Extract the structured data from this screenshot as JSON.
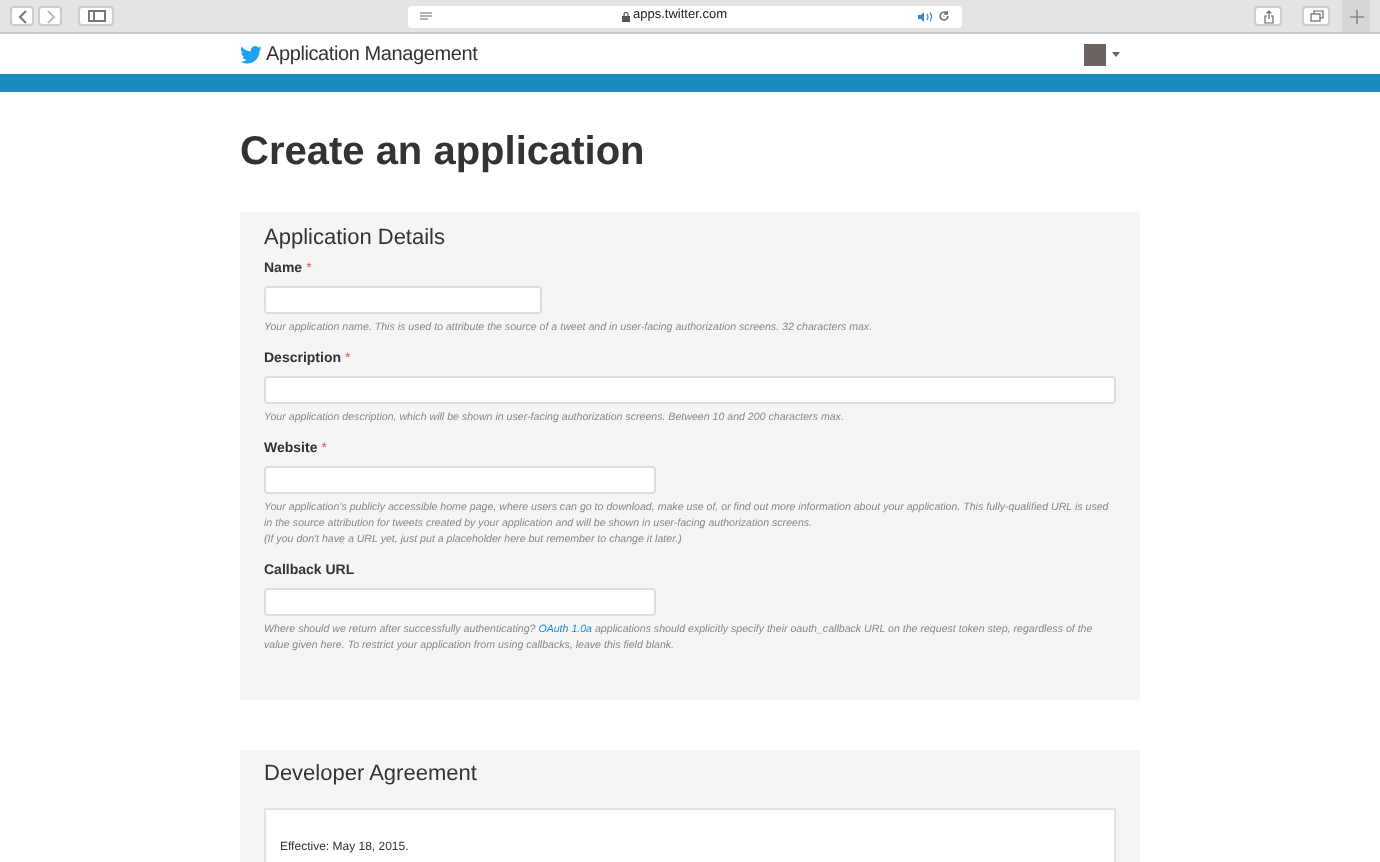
{
  "browser": {
    "address": "apps.twitter.com"
  },
  "header": {
    "title": "Application Management"
  },
  "page_title": "Create an application",
  "details": {
    "heading": "Application Details",
    "fields": [
      {
        "label": "Name",
        "required_mark": "*",
        "help": [
          "Your application name. This is used to attribute the source of a tweet and in user-facing authorization screens. 32 characters max."
        ]
      },
      {
        "label": "Description",
        "required_mark": "*",
        "help": [
          "Your application description, which will be shown in user-facing authorization screens. Between 10 and 200 characters max."
        ]
      },
      {
        "label": "Website",
        "required_mark": "*",
        "help": [
          "Your application's publicly accessible home page, where users can go to download, make use of, or find out more information about your application. This fully-qualified URL is used in the source attribution for tweets created by your application and will be shown in user-facing authorization screens.",
          "(If you don't have a URL yet, just put a placeholder here but remember to change it later.)"
        ]
      },
      {
        "label": "Callback URL",
        "help_link": {
          "before": "Where should we return after successfully authenticating? ",
          "link": "OAuth 1.0a",
          "after": " applications should explicitly specify their oauth_callback URL on the request token step, regardless of the value given here. To restrict your application from using callbacks, leave this field blank."
        }
      }
    ]
  },
  "agreement": {
    "heading": "Developer Agreement",
    "effective": "Effective: May 18, 2015."
  }
}
